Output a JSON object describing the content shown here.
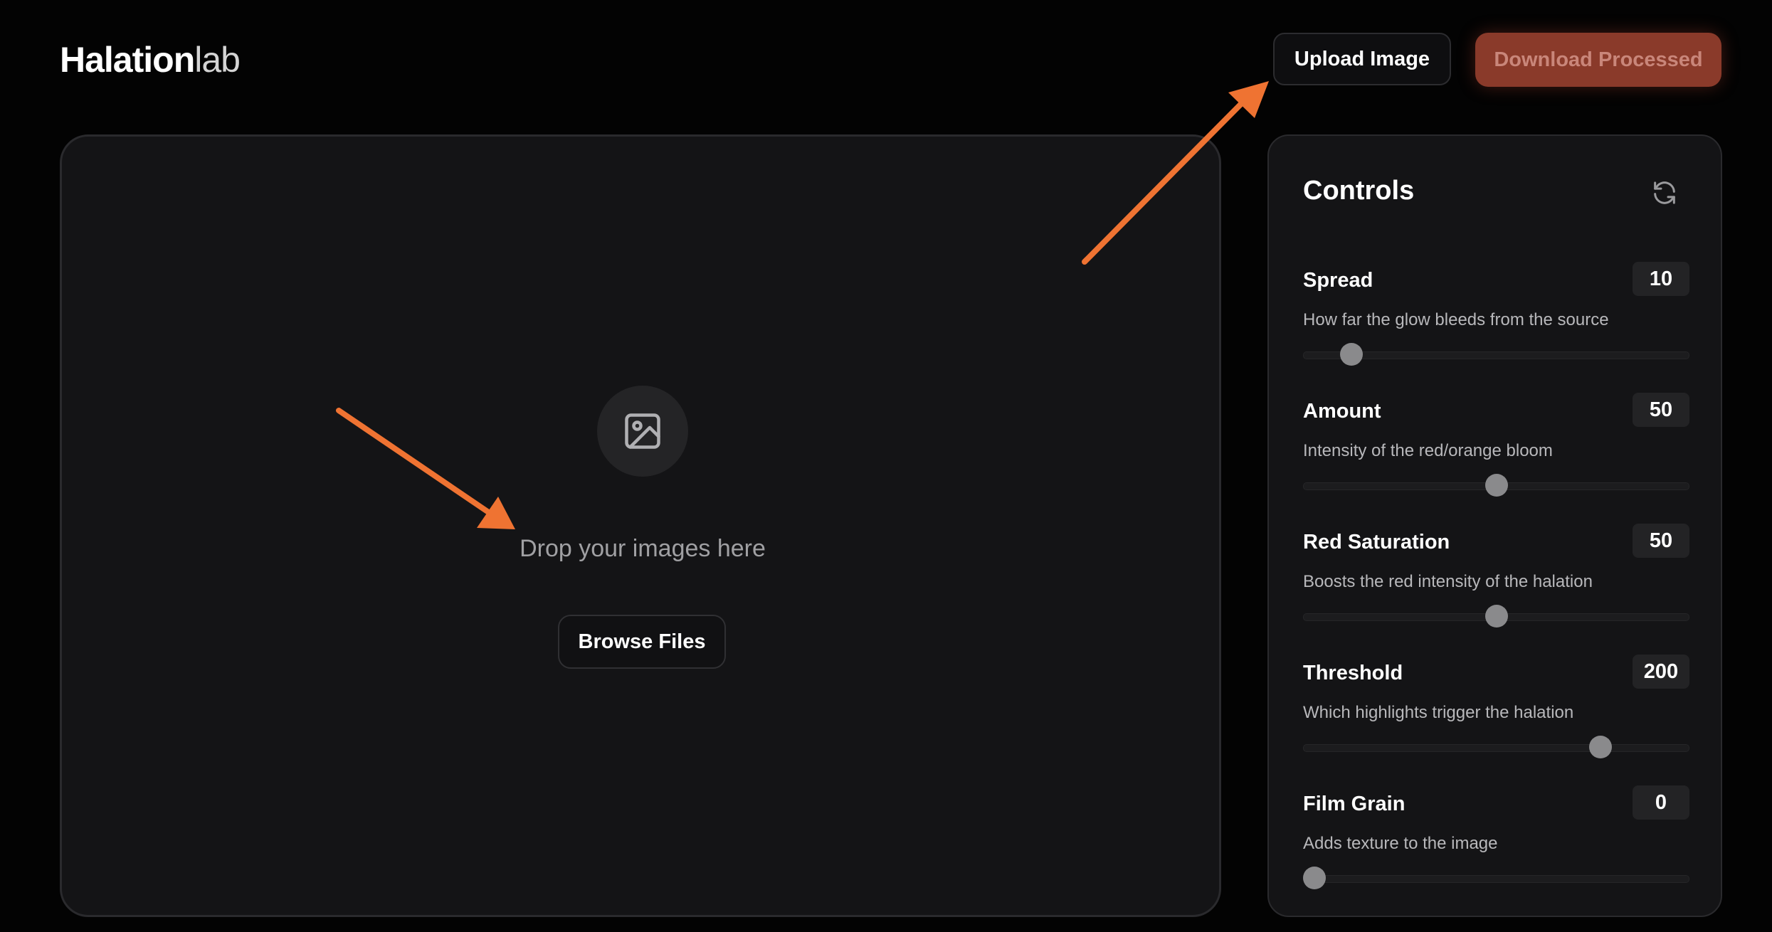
{
  "app": {
    "logo_bold": "Halation",
    "logo_light": "lab"
  },
  "header": {
    "upload_label": "Upload Image",
    "download_label": "Download Processed"
  },
  "dropzone": {
    "icon": "image-icon",
    "text": "Drop your images here",
    "browse_label": "Browse Files"
  },
  "controls": {
    "title": "Controls",
    "reset_icon": "refresh-icon",
    "items": [
      {
        "label": "Spread",
        "value": "10",
        "description": "How far the glow bleeds from the source",
        "fraction": 0.125
      },
      {
        "label": "Amount",
        "value": "50",
        "description": "Intensity of the red/orange bloom",
        "fraction": 0.5
      },
      {
        "label": "Red Saturation",
        "value": "50",
        "description": "Boosts the red intensity of the halation",
        "fraction": 0.5
      },
      {
        "label": "Threshold",
        "value": "200",
        "description": "Which highlights trigger the halation",
        "fraction": 0.77
      },
      {
        "label": "Film Grain",
        "value": "0",
        "description": "Adds texture to the image",
        "fraction": 0.03
      }
    ]
  },
  "colors": {
    "background": "#030303",
    "panel": "#141416",
    "accent_download": "#8a3a2a",
    "annotation_arrow": "#ef7332"
  }
}
